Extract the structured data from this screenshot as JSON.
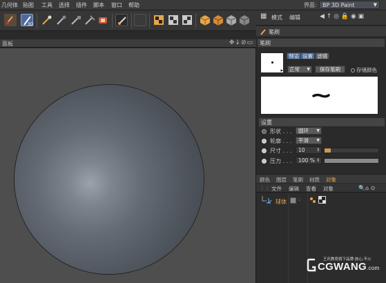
{
  "menubar": {
    "items": [
      "几何体",
      "贴图",
      "工具",
      "选择",
      "插件",
      "脚本",
      "窗口",
      "帮助"
    ],
    "layout_label": "界面:",
    "layout_value": "BP 3D Paint"
  },
  "viewport": {
    "title": "面板",
    "nav_icons": "✥↓⊘▭"
  },
  "right_panel": {
    "top_tabs": [
      "模式",
      "编辑"
    ],
    "title": "笔刷",
    "brush_header": "笔刷",
    "preset_tabs": [
      "预览",
      "设置",
      "滤镜"
    ],
    "blend_mode": "正常",
    "save_brush_label": "保存笔刷",
    "store_color_label": "存储颜色",
    "settings_header": "设置",
    "settings": [
      {
        "label": "形状 . . .",
        "value": "圆环"
      },
      {
        "label": "轮廓 . . .",
        "value": "平滑"
      },
      {
        "label": "尺寸 . . .",
        "value": "10",
        "level": 0.12
      },
      {
        "label": "压力 . . .",
        "value": "100 %",
        "level": 1.0
      }
    ]
  },
  "object_manager": {
    "tabs": [
      "颜色",
      "图层",
      "笔刷",
      "材质",
      "对象"
    ],
    "active_tab": "对象",
    "menu": [
      "文件",
      "编辑",
      "查看",
      "对象"
    ],
    "object_name": "球体"
  },
  "watermark": {
    "tagline": "王氏教育旗下品牌·放心,不火",
    "brand": "CGWANG",
    "domain": ".com"
  },
  "colors": {
    "accent_orange": "#e8a64a",
    "selected_tab_blue": "#4c6b96",
    "viewport_bg": "#4e4e4e"
  }
}
